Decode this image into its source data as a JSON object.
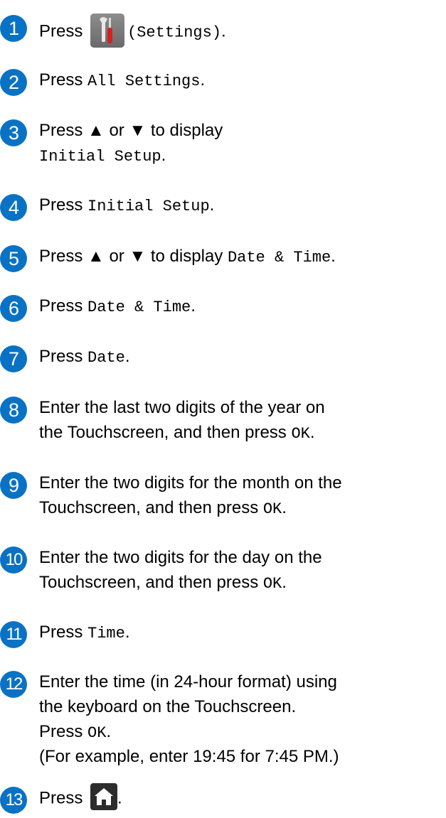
{
  "steps": [
    {
      "num": "1",
      "pre": "Press ",
      "code": "(Settings)",
      "post": "."
    },
    {
      "num": "2",
      "pre": "Press ",
      "code": "All Settings",
      "post": "."
    },
    {
      "num": "3",
      "line1": "Press ▲ or ▼ to display",
      "code": "Initial Setup",
      "post": "."
    },
    {
      "num": "4",
      "pre": "Press ",
      "code": "Initial Setup",
      "post": "."
    },
    {
      "num": "5",
      "pre": "Press ▲ or ▼ to display ",
      "code": "Date & Time",
      "post": "."
    },
    {
      "num": "6",
      "pre": "Press ",
      "code": "Date & Time",
      "post": "."
    },
    {
      "num": "7",
      "pre": "Press ",
      "code": "Date",
      "post": "."
    },
    {
      "num": "8",
      "line1": "Enter the last two digits of the year on",
      "line2": "the Touchscreen, and then press ",
      "code": "OK",
      "post": "."
    },
    {
      "num": "9",
      "line1": "Enter the two digits for the month on the",
      "line2": "Touchscreen, and then press ",
      "code": "OK",
      "post": "."
    },
    {
      "num": "10",
      "line1": "Enter the two digits for the day on the",
      "line2": "Touchscreen, and then press ",
      "code": "OK",
      "post": "."
    },
    {
      "num": "11",
      "pre": "Press ",
      "code": "Time",
      "post": "."
    },
    {
      "num": "12",
      "line1": "Enter the time (in 24-hour format) using",
      "line2": "the keyboard on the Touchscreen.",
      "line3": "Press ",
      "code": "OK",
      "post": ".",
      "line4": "(For example, enter 19:45 for 7:45 PM.)"
    },
    {
      "num": "13",
      "pre": "Press ",
      "post": "."
    }
  ],
  "icons": {
    "settings": "settings-tools-icon",
    "home": "home-icon"
  },
  "colors": {
    "badge": "#0a72c4",
    "text": "#000000"
  }
}
